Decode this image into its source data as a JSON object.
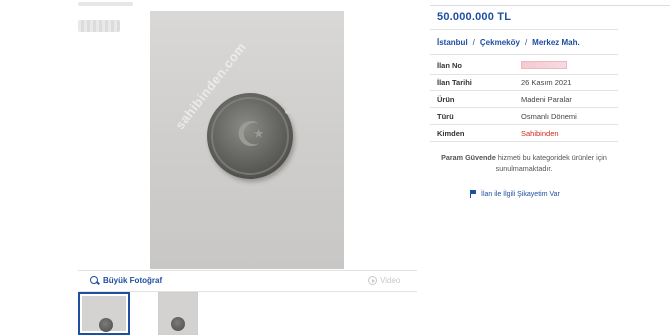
{
  "listing": {
    "price": "50.000.000 TL",
    "location": {
      "city": "İstanbul",
      "district": "Çekmeköy",
      "neighborhood": "Merkez Mah.",
      "separator": "/"
    },
    "details": [
      {
        "key": "İlan No",
        "value": "",
        "blurred": true
      },
      {
        "key": "İlan Tarihi",
        "value": "26 Kasım 2021"
      },
      {
        "key": "Ürün",
        "value": "Madeni Paralar"
      },
      {
        "key": "Türü",
        "value": "Osmanlı Dönemi"
      },
      {
        "key": "Kimden",
        "value": "Sahibinden",
        "highlight": true
      }
    ],
    "param_guvende": {
      "brand": "Param Güvende",
      "text": "hizmeti bu kategoridek ürünler için sunulmamaktadır."
    },
    "report_link": "İlan ile İlgili Şikayetim Var"
  },
  "gallery": {
    "big_photo_label": "Büyük Fotoğraf",
    "video_label": "Video",
    "watermark": "sahibinden.com",
    "thumbnails": 2,
    "selected_thumbnail": 1
  },
  "colors": {
    "link_blue": "#1f4fa0",
    "seller_red": "#cc2b1d",
    "divider": "#e3e3e3"
  },
  "icons": [
    "search-icon",
    "play-icon",
    "flag-icon"
  ]
}
